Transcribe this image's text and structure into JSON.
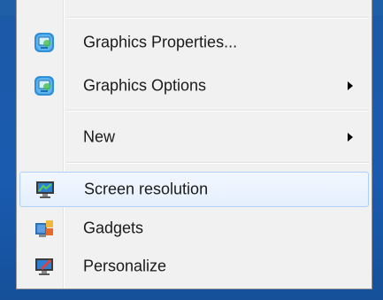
{
  "context_menu": {
    "items": [
      {
        "label": "Graphics Properties...",
        "icon": "intel-graphics-icon",
        "submenu": false
      },
      {
        "label": "Graphics Options",
        "icon": "intel-graphics-icon",
        "submenu": true
      },
      {
        "label": "New",
        "icon": "",
        "submenu": true
      },
      {
        "label": "Screen resolution",
        "icon": "monitor-icon",
        "submenu": false,
        "highlighted": true
      },
      {
        "label": "Gadgets",
        "icon": "gadgets-icon",
        "submenu": false
      },
      {
        "label": "Personalize",
        "icon": "personalize-icon",
        "submenu": false
      }
    ]
  },
  "colors": {
    "menu_bg": "#f1f1f1",
    "hover_border": "#aecff7",
    "desktop_blue": "#1c5aa6"
  }
}
